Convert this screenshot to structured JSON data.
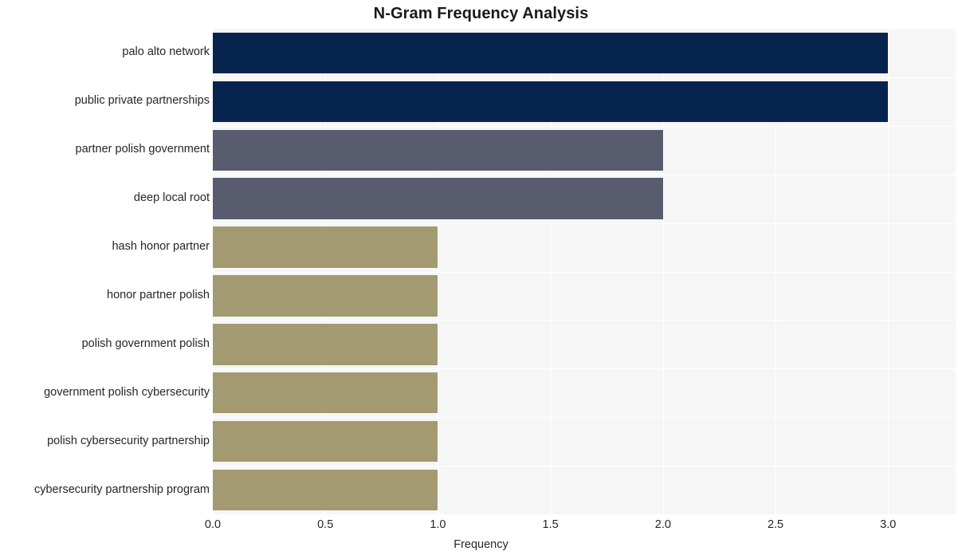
{
  "chart_data": {
    "type": "bar",
    "orientation": "horizontal",
    "title": "N-Gram Frequency Analysis",
    "xlabel": "Frequency",
    "ylabel": "",
    "xlim": [
      0.0,
      3.3
    ],
    "xticks": [
      "0.0",
      "0.5",
      "1.0",
      "1.5",
      "2.0",
      "2.5",
      "3.0"
    ],
    "xtick_values": [
      0.0,
      0.5,
      1.0,
      1.5,
      2.0,
      2.5,
      3.0
    ],
    "grid": true,
    "legend": "none",
    "categories": [
      "palo alto network",
      "public private partnerships",
      "partner polish government",
      "deep local root",
      "hash honor partner",
      "honor partner polish",
      "polish government polish",
      "government polish cybersecurity",
      "polish cybersecurity partnership",
      "cybersecurity partnership program"
    ],
    "values": [
      3,
      3,
      2,
      2,
      1,
      1,
      1,
      1,
      1,
      1
    ],
    "bar_colors": [
      "#06244d",
      "#06244d",
      "#585c6e",
      "#585c6e",
      "#a39a71",
      "#a39a71",
      "#a39a71",
      "#a39a71",
      "#a39a71",
      "#a39a71"
    ],
    "plot_background": "#f6f6f7",
    "grid_color": "#ffffff",
    "figure_background": "#ffffff",
    "title_color": "#1a1a1a",
    "tick_label_color": "#262626"
  }
}
